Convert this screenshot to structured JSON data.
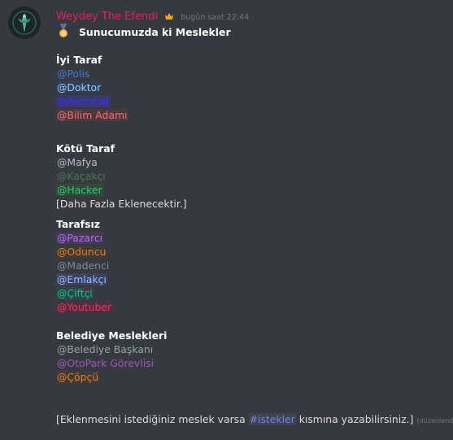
{
  "message": {
    "username": "Weydey The Efendi",
    "timestamp": "bugün saat 22:44",
    "title": "Sunucumuzda ki Meslekler",
    "edited_label": "(düzenlendi)"
  },
  "sections": [
    {
      "heading": "İyi Taraf",
      "roles": [
        {
          "label": "@Polis",
          "color": "#3d7cd6",
          "bg": "#36393f"
        },
        {
          "label": "@Doktor",
          "color": "#9cc8ff",
          "bg": "#2f3f55"
        },
        {
          "label": "@Astronot",
          "color": "#3a2cff",
          "bg": "#3a3a6a"
        },
        {
          "label": "@Bilim Adamı",
          "color": "#ff6b6b",
          "bg": "#4a3a40"
        }
      ]
    },
    {
      "heading": "Kötü Taraf",
      "roles": [
        {
          "label": "@Mafya",
          "color": "#b9bbbe",
          "bg": "#36393f"
        },
        {
          "label": "@Kaçakçı",
          "color": "#4a7a4a",
          "bg": "#36393f"
        },
        {
          "label": "@Hacker",
          "color": "#2ecc71",
          "bg": "#2f4a3a"
        }
      ],
      "note": "[Daha Fazla Eklenecektir.]"
    },
    {
      "heading": "Tarafsız",
      "roles": [
        {
          "label": "@Pazarcı",
          "color": "#b86bff",
          "bg": "#453a55"
        },
        {
          "label": "@Oduncu",
          "color": "#e67e22",
          "bg": "#3f3a36"
        },
        {
          "label": "@Madenci",
          "color": "#7f8c8d",
          "bg": "#36393f"
        },
        {
          "label": "@Emlakçı",
          "color": "#9fb8ff",
          "bg": "#3a4260"
        },
        {
          "label": "@Çiftçi",
          "color": "#1abc9c",
          "bg": "#2f4743"
        },
        {
          "label": "@Youtuber",
          "color": "#ff2d55",
          "bg": "#4a3040"
        }
      ]
    },
    {
      "heading": "Belediye Meslekleri",
      "roles": [
        {
          "label": "@Belediye Başkanı",
          "color": "#95a5a6",
          "bg": "#36393f"
        },
        {
          "label": "@OtoPark Görevlisi",
          "color": "#9b59b6",
          "bg": "#36393f"
        },
        {
          "label": "@Çöpçü",
          "color": "#e67e22",
          "bg": "#403a38"
        }
      ]
    }
  ],
  "footer": {
    "before": "[Eklenmesini istediğiniz meslek varsa ",
    "channel": "#istekler",
    "after": " kısmına yazabilirsiniz.]"
  },
  "icons": {
    "avatar": "avatar-emblem-icon",
    "crown": "crown-icon",
    "medal": "medal-icon"
  }
}
